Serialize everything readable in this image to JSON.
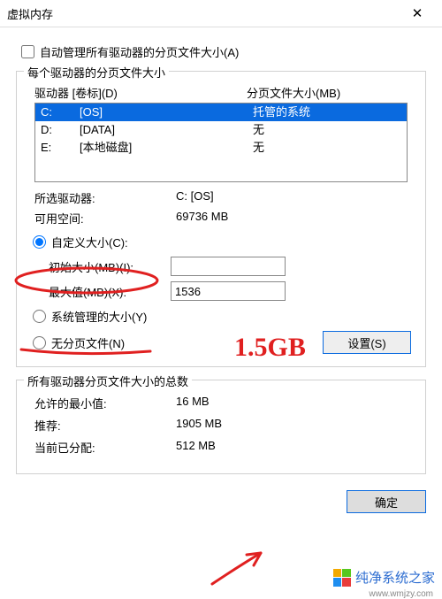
{
  "window": {
    "title": "虚拟内存"
  },
  "auto_manage": {
    "label": "自动管理所有驱动器的分页文件大小(A)",
    "checked": false
  },
  "drives_group": {
    "label": "每个驱动器的分页文件大小",
    "header_drive": "驱动器 [卷标](D)",
    "header_page": "分页文件大小(MB)",
    "rows": [
      {
        "letter": "C:",
        "label": "[OS]",
        "page": "托管的系统",
        "selected": true
      },
      {
        "letter": "D:",
        "label": "[DATA]",
        "page": "无",
        "selected": false
      },
      {
        "letter": "E:",
        "label": "[本地磁盘]",
        "page": "无",
        "selected": false
      }
    ],
    "selected_drive_label": "所选驱动器:",
    "selected_drive_value": "C:  [OS]",
    "free_space_label": "可用空间:",
    "free_space_value": "69736 MB",
    "radio_custom": "自定义大小(C):",
    "initial_label": "初始大小(MB)(I):",
    "initial_value": "",
    "max_label": "最大值(MB)(X):",
    "max_value": "1536",
    "radio_system": "系统管理的大小(Y)",
    "radio_none": "无分页文件(N)",
    "set_button": "设置(S)"
  },
  "totals_group": {
    "label": "所有驱动器分页文件大小的总数",
    "min_label": "允许的最小值:",
    "min_value": "16 MB",
    "rec_label": "推荐:",
    "rec_value": "1905 MB",
    "cur_label": "当前已分配:",
    "cur_value": "512 MB"
  },
  "buttons": {
    "ok": "确定"
  },
  "watermark": {
    "text": "纯净系统之家",
    "url": "www.wmjzy.com"
  },
  "annotations": {
    "text1": "1.5GB"
  }
}
